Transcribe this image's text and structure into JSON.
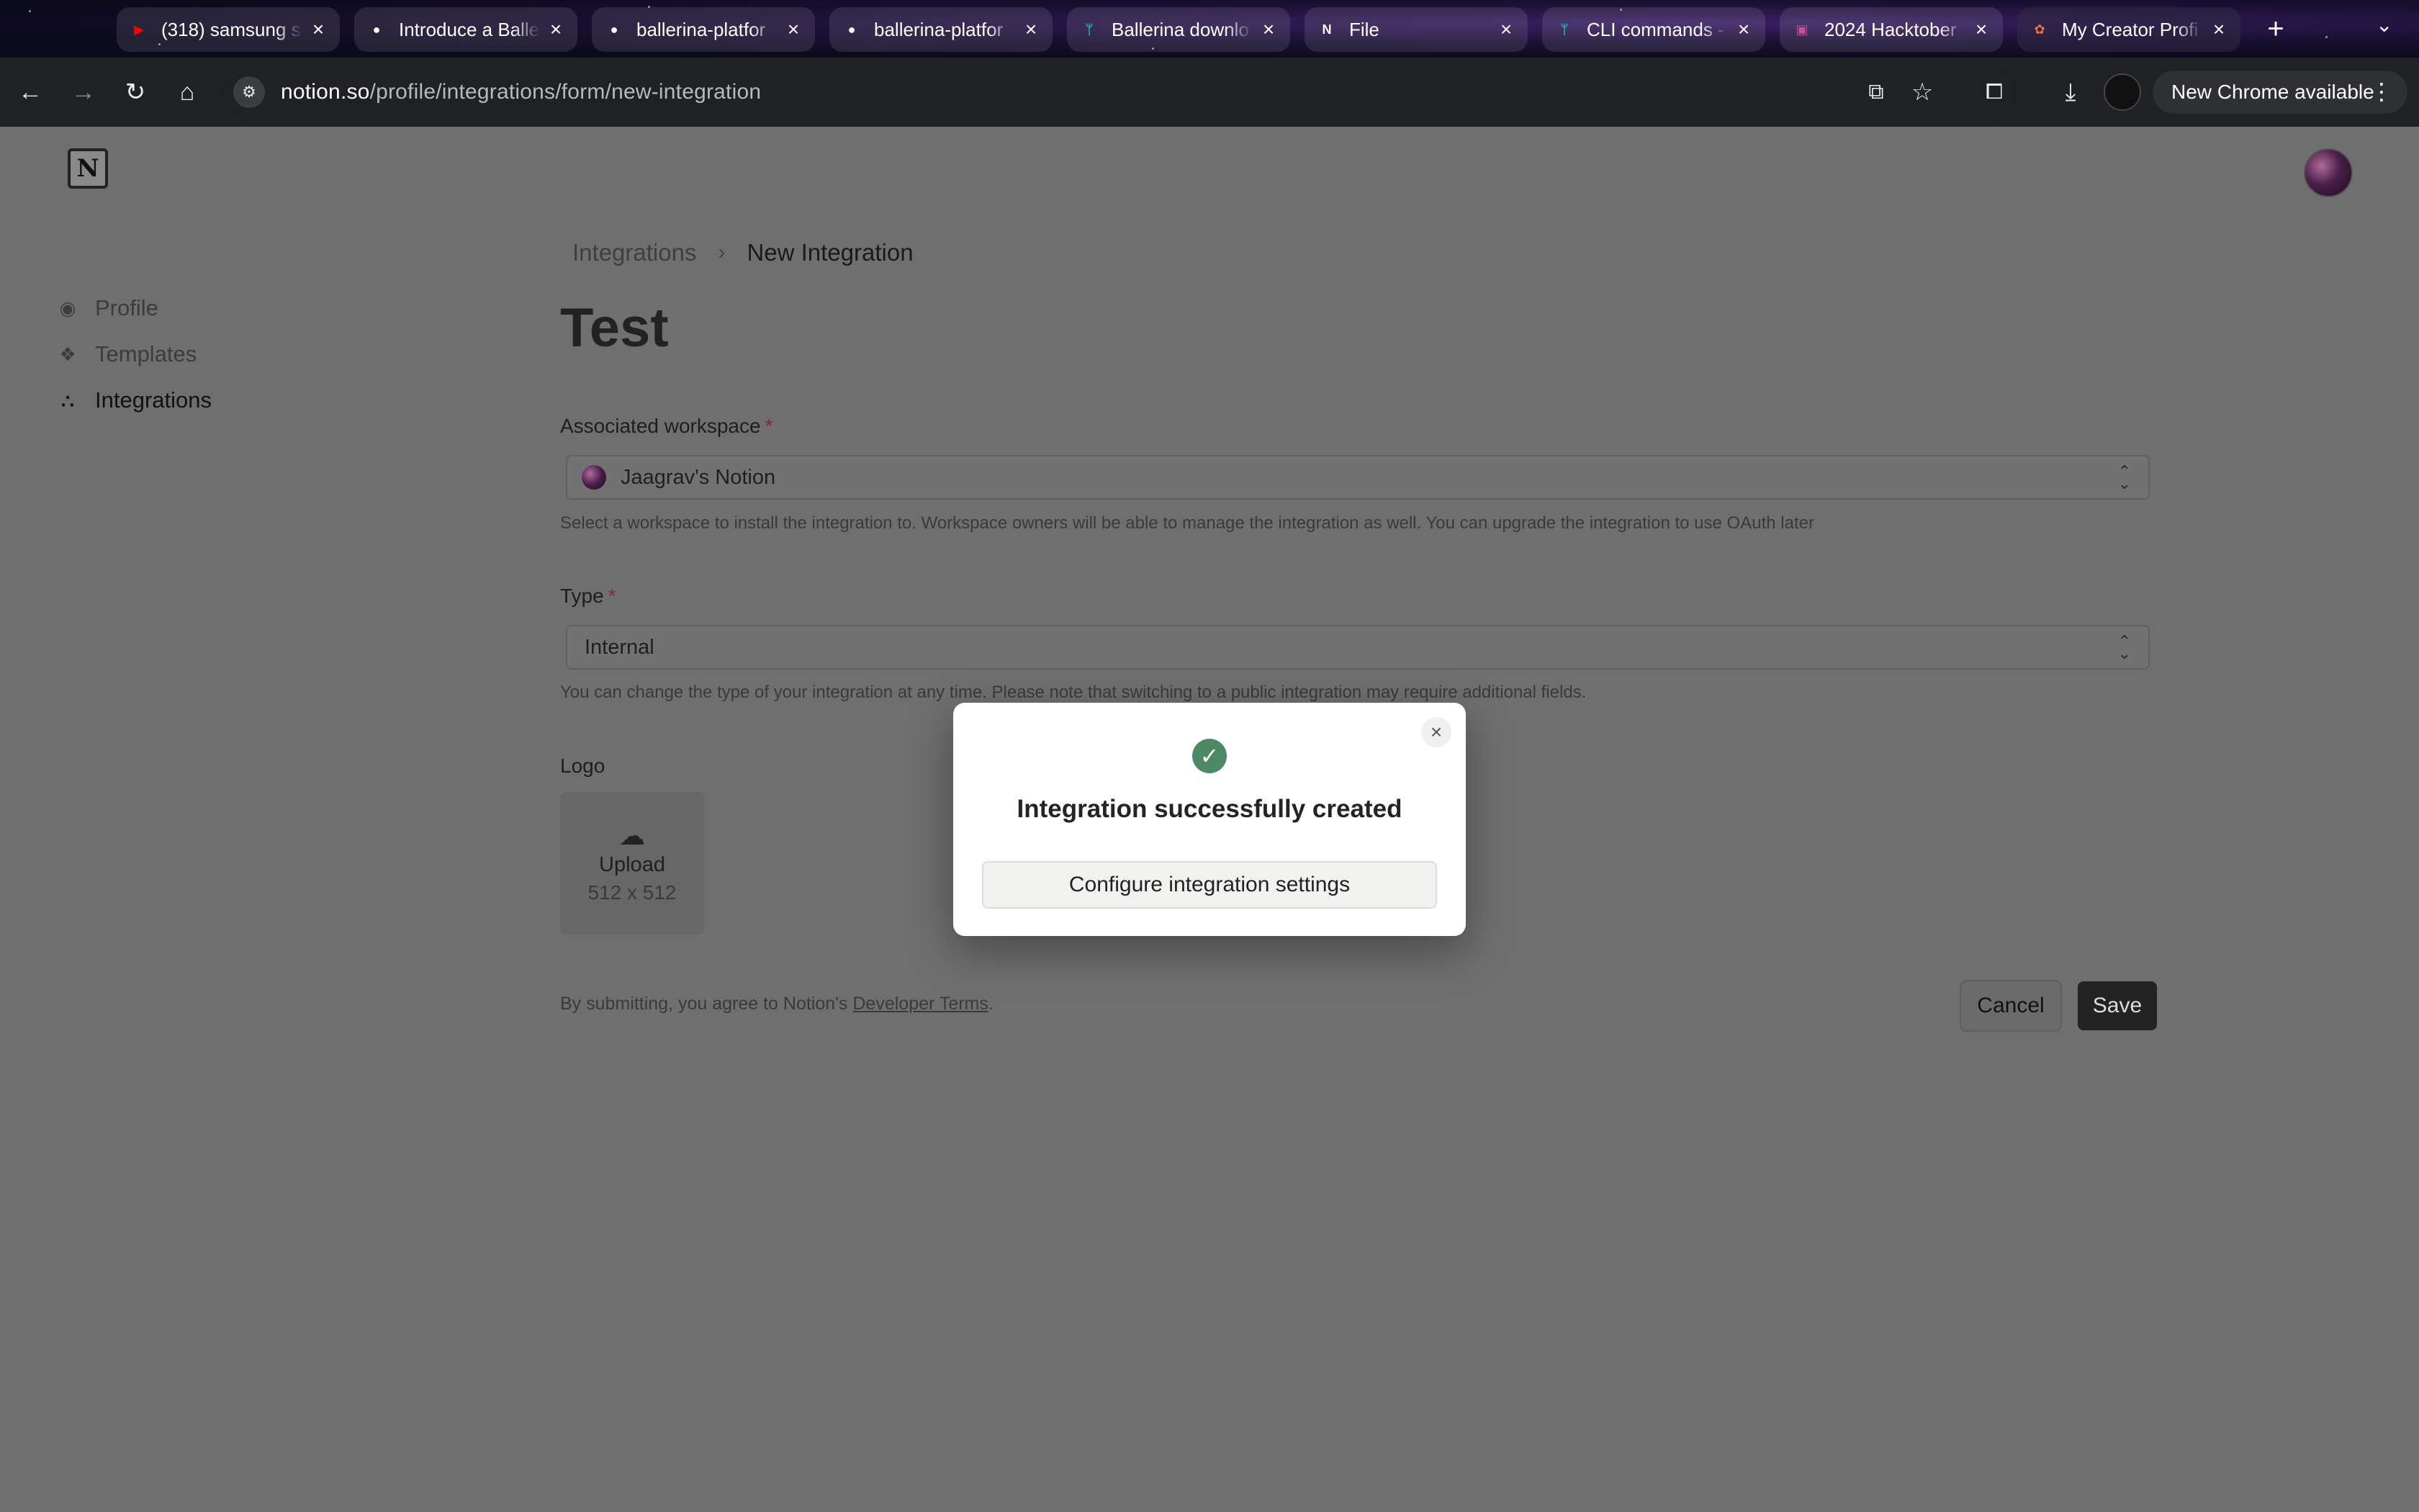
{
  "browser": {
    "tabs": [
      {
        "title": "(318) samsung s",
        "favicon": "youtube-icon",
        "color": "#ff0000",
        "glyph": "▶"
      },
      {
        "title": "Introduce a Balle",
        "favicon": "github-icon",
        "color": "#ffffff",
        "glyph": "●"
      },
      {
        "title": "ballerina-platfor",
        "favicon": "github-icon",
        "color": "#ffffff",
        "glyph": "●"
      },
      {
        "title": "ballerina-platfor",
        "favicon": "github-icon",
        "color": "#ffffff",
        "glyph": "●"
      },
      {
        "title": "Ballerina downlo",
        "favicon": "ballerina-icon",
        "color": "#20b6b0",
        "glyph": "ᛘ"
      },
      {
        "title": "File",
        "favicon": "notion-icon",
        "color": "#ffffff",
        "glyph": "N"
      },
      {
        "title": "CLI commands -",
        "favicon": "ballerina-icon",
        "color": "#20b6b0",
        "glyph": "ᛘ"
      },
      {
        "title": "2024 Hacktober",
        "favicon": "hacktoberfest-icon",
        "color": "#c8519b",
        "glyph": "▣"
      },
      {
        "title": "My Creator Profi",
        "favicon": "notion-creator-icon",
        "color": "#e8743b",
        "glyph": "✿"
      }
    ],
    "url_host": "notion.so",
    "url_path": "/profile/integrations/form/new-integration",
    "update_pill": "New Chrome available"
  },
  "sidebar": {
    "items": [
      {
        "label": "Profile",
        "icon": "profile-icon"
      },
      {
        "label": "Templates",
        "icon": "templates-icon"
      },
      {
        "label": "Integrations",
        "icon": "integrations-icon"
      }
    ]
  },
  "breadcrumb": {
    "parent": "Integrations",
    "current": "New Integration"
  },
  "form": {
    "title": "Test",
    "workspace": {
      "label": "Associated workspace",
      "required_mark": "*",
      "value": "Jaagrav's Notion",
      "help": "Select a workspace to install the integration to. Workspace owners will be able to manage the integration as well. You can upgrade the integration to use OAuth later"
    },
    "type": {
      "label": "Type",
      "required_mark": "*",
      "value": "Internal",
      "help": "You can change the type of your integration at any time. Please note that switching to a public integration may require additional fields."
    },
    "logo": {
      "label": "Logo",
      "upload": "Upload",
      "size": "512 x 512"
    },
    "terms_prefix": "By submitting, you agree to Notion's ",
    "terms_link": "Developer Terms",
    "terms_suffix": ".",
    "cancel": "Cancel",
    "save": "Save"
  },
  "modal": {
    "title": "Integration successfully created",
    "button": "Configure integration settings",
    "success_color": "#4b8a65"
  }
}
